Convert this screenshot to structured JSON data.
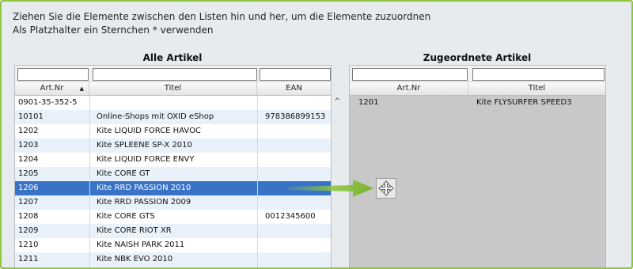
{
  "instructions": {
    "line1": "Ziehen Sie die Elemente zwischen den Listen hin und her, um die Elemente zuzuordnen",
    "line2": "Als Platzhalter ein Sternchen * verwenden"
  },
  "left_list": {
    "title": "Alle Artikel",
    "columns": [
      "Art.Nr",
      "Titel",
      "EAN"
    ],
    "sort_indicator": "▲",
    "rows": [
      {
        "artnr": "0901-35-352-5",
        "titel": "",
        "ean": ""
      },
      {
        "artnr": "10101",
        "titel": "Online-Shops mit OXID eShop",
        "ean": "978386899153"
      },
      {
        "artnr": "1202",
        "titel": "Kite LIQUID FORCE HAVOC",
        "ean": ""
      },
      {
        "artnr": "1203",
        "titel": "Kite SPLEENE SP-X 2010",
        "ean": ""
      },
      {
        "artnr": "1204",
        "titel": "Kite LIQUID FORCE ENVY",
        "ean": ""
      },
      {
        "artnr": "1205",
        "titel": "Kite CORE GT",
        "ean": ""
      },
      {
        "artnr": "1206",
        "titel": "Kite RRD PASSION 2010",
        "ean": ""
      },
      {
        "artnr": "1207",
        "titel": "Kite RRD PASSION 2009",
        "ean": ""
      },
      {
        "artnr": "1208",
        "titel": "Kite CORE GTS",
        "ean": "0012345600"
      },
      {
        "artnr": "1209",
        "titel": "Kite CORE RIOT XR",
        "ean": ""
      },
      {
        "artnr": "1210",
        "titel": "Kite NAISH PARK 2011",
        "ean": ""
      },
      {
        "artnr": "1211",
        "titel": "Kite NBK EVO 2010",
        "ean": ""
      }
    ],
    "selected_row": "1206",
    "scroll_up_glyph": "^"
  },
  "right_list": {
    "title": "Zugeordnete Artikel",
    "columns": [
      "Art.Nr",
      "Titel"
    ],
    "sort_indicator": "",
    "rows": [
      {
        "artnr": "1201",
        "titel": "Kite FLYSURFER SPEED3"
      }
    ]
  },
  "colors": {
    "frame_border": "#8dc63f",
    "selection": "#3873c7",
    "alt_row": "#e9f1fa",
    "assigned_bg": "#c8c8c8",
    "drag_arrow": "#8dc63f"
  },
  "icons": {
    "drag_handle": "move-icon",
    "drag_arrow": "arrow-right-icon",
    "sort": "sort-ascending-icon"
  }
}
